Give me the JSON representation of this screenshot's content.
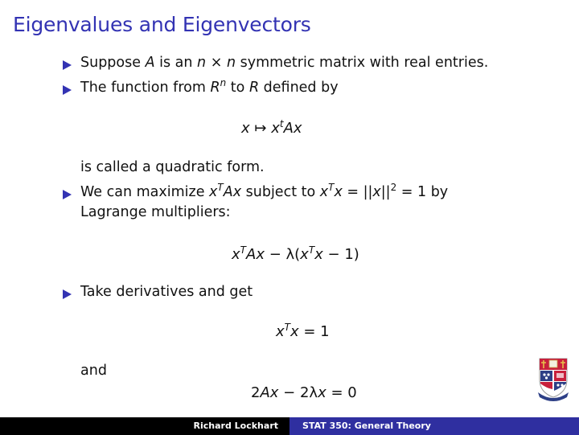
{
  "slide": {
    "title": "Eigenvalues and Eigenvectors",
    "bullets": [
      {
        "text_parts": [
          "Suppose ",
          "A",
          " is an ",
          "n",
          " × ",
          "n",
          " symmetric matrix with real entries."
        ]
      },
      {
        "text_parts": [
          "The function from ",
          "R",
          "n",
          " to ",
          "R",
          " defined by"
        ]
      },
      {
        "text_parts": [
          "We can maximize ",
          "x",
          "T",
          "Ax",
          " subject to ",
          "x",
          "T",
          "x",
          " = ||",
          "x",
          "||",
          "2",
          " = 1 by"
        ],
        "line2": "Lagrange multipliers:"
      },
      {
        "text_parts": [
          "Take derivatives and get"
        ]
      }
    ],
    "equations": {
      "quadratic_map": [
        "x",
        " ↦ ",
        "x",
        "t",
        "Ax"
      ],
      "quadratic_form_note": "is called a quadratic form.",
      "lagrangian": [
        "x",
        "T",
        "Ax",
        " − λ(",
        "x",
        "T",
        "x",
        " − 1)"
      ],
      "constraint": [
        "x",
        "T",
        "x",
        " = 1"
      ],
      "and_label": "and",
      "eigen_eq": [
        "2",
        "Ax",
        " − 2λ",
        "x",
        " = 0"
      ]
    },
    "footer": {
      "author": "Richard Lockhart",
      "course": "STAT 350: General Theory"
    },
    "logo": "university-crest-icon",
    "colors": {
      "accent": "#3333b3",
      "footer_right": "#2f2fa0",
      "footer_left": "#000000"
    }
  }
}
